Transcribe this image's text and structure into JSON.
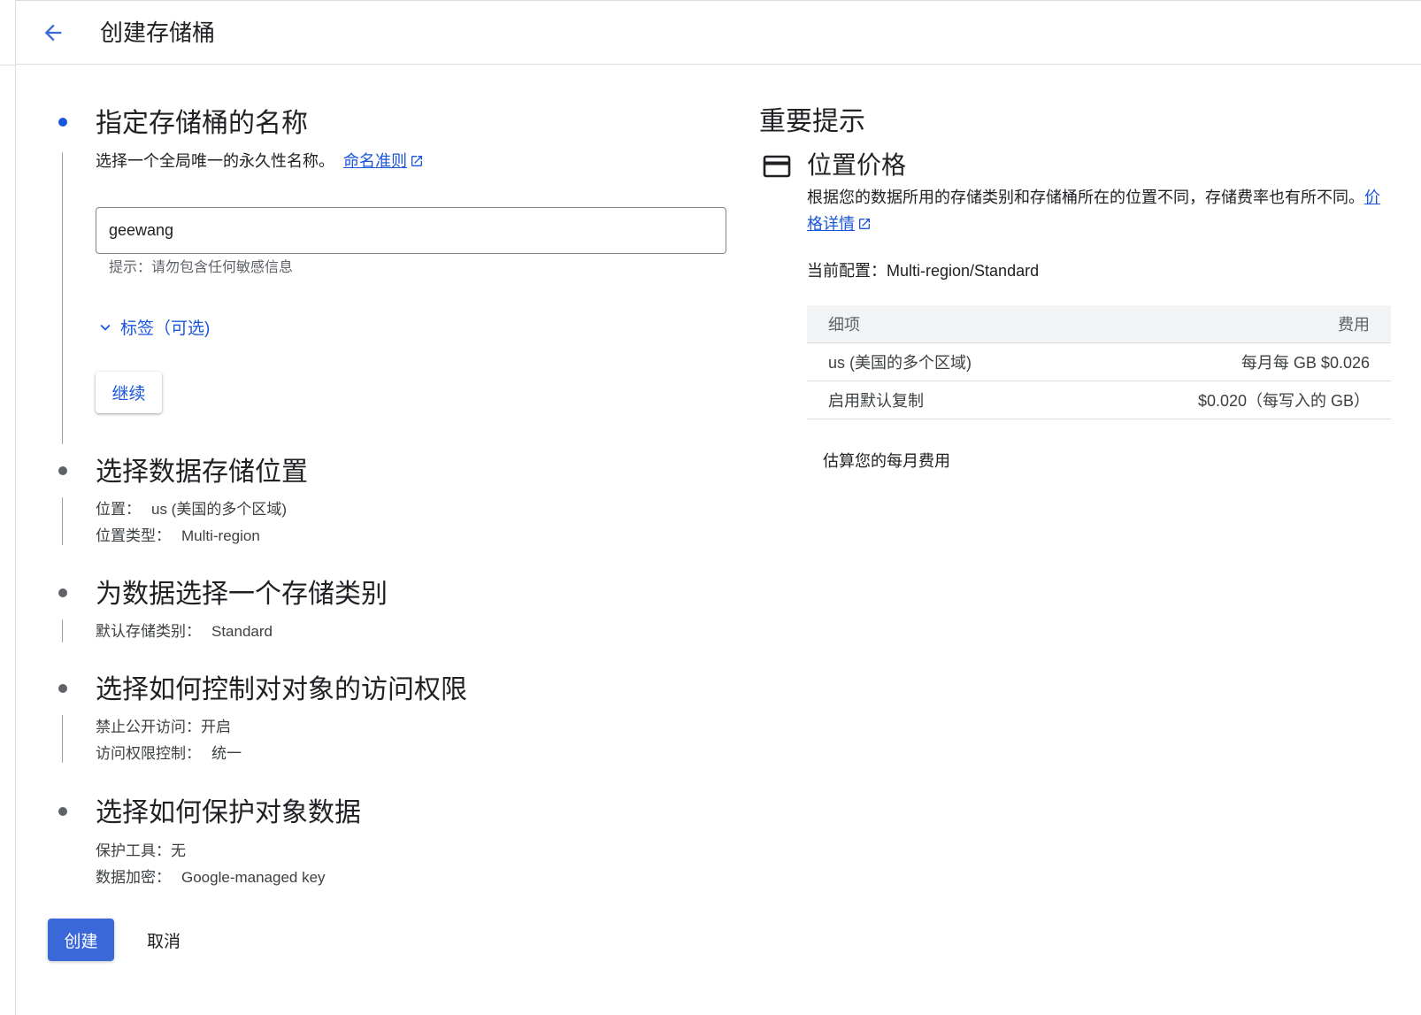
{
  "header": {
    "title": "创建存储桶"
  },
  "colors": {
    "accent": "#1a56db",
    "primary_button": "#3b68d8",
    "active_step": "#1a56db",
    "inactive_step": "#5f6368"
  },
  "step1": {
    "title": "指定存储桶的名称",
    "description": "选择一个全局唯一的永久性名称。",
    "naming_link": "命名准则",
    "input_value": "geewang",
    "hint": "提示：请勿包含任何敏感信息",
    "labels_toggle": "标签（可选)",
    "continue_label": "继续"
  },
  "step2": {
    "title": "选择数据存储位置",
    "lines": [
      {
        "label": "位置：",
        "value": "us (美国的多个区域)"
      },
      {
        "label": "位置类型：",
        "value": "Multi-region"
      }
    ]
  },
  "step3": {
    "title": "为数据选择一个存储类别",
    "lines": [
      {
        "label": "默认存储类别：",
        "value": "Standard"
      }
    ]
  },
  "step4": {
    "title": "选择如何控制对对象的访问权限",
    "lines": [
      {
        "label": "禁止公开访问：开启",
        "value": ""
      },
      {
        "label": "访问权限控制：",
        "value": "统一"
      }
    ]
  },
  "step5": {
    "title": "选择如何保护对象数据",
    "lines": [
      {
        "label": "保护工具：无",
        "value": ""
      },
      {
        "label": "数据加密：",
        "value": "Google-managed key"
      }
    ]
  },
  "actions": {
    "create": "创建",
    "cancel": "取消"
  },
  "right_panel": {
    "title": "重要提示",
    "subtitle": "位置价格",
    "description": "根据您的数据所用的存储类别和存储桶所在的位置不同，存储费率也有所不同。",
    "pricing_link": "价格详情",
    "current_config": "当前配置：Multi-region/Standard",
    "table": {
      "headers": [
        "细项",
        "费用"
      ],
      "rows": [
        [
          "us (美国的多个区域)",
          "每月每 GB $0.026"
        ],
        [
          "启用默认复制",
          "$0.020（每写入的 GB）"
        ]
      ]
    },
    "estimate_link": "估算您的每月费用"
  }
}
